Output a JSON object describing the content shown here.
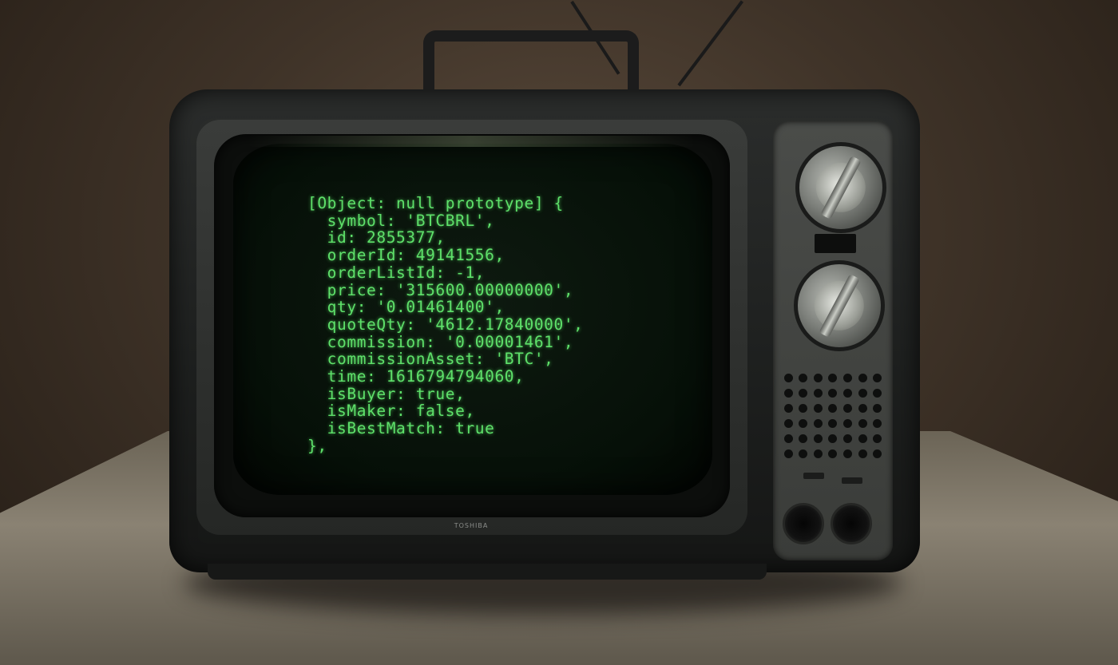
{
  "photo": {
    "subject": "vintage portable television",
    "screen_text_color": "#5ee06a",
    "wall_color": "#4a3c30",
    "tv_body_color": "#1f2120"
  },
  "screen": {
    "lines": [
      "[Object: null prototype] {",
      "  symbol: 'BTCBRL',",
      "  id: 2855377,",
      "  orderId: 49141556,",
      "  orderListId: -1,",
      "  price: '315600.00000000',",
      "  qty: '0.01461400',",
      "  quoteQty: '4612.17840000',",
      "  commission: '0.00001461',",
      "  commissionAsset: 'BTC',",
      "  time: 1616794794060,",
      "  isBuyer: true,",
      "  isMaker: false,",
      "  isBestMatch: true",
      "},"
    ]
  },
  "tv": {
    "brand": "TOSHIBA"
  }
}
